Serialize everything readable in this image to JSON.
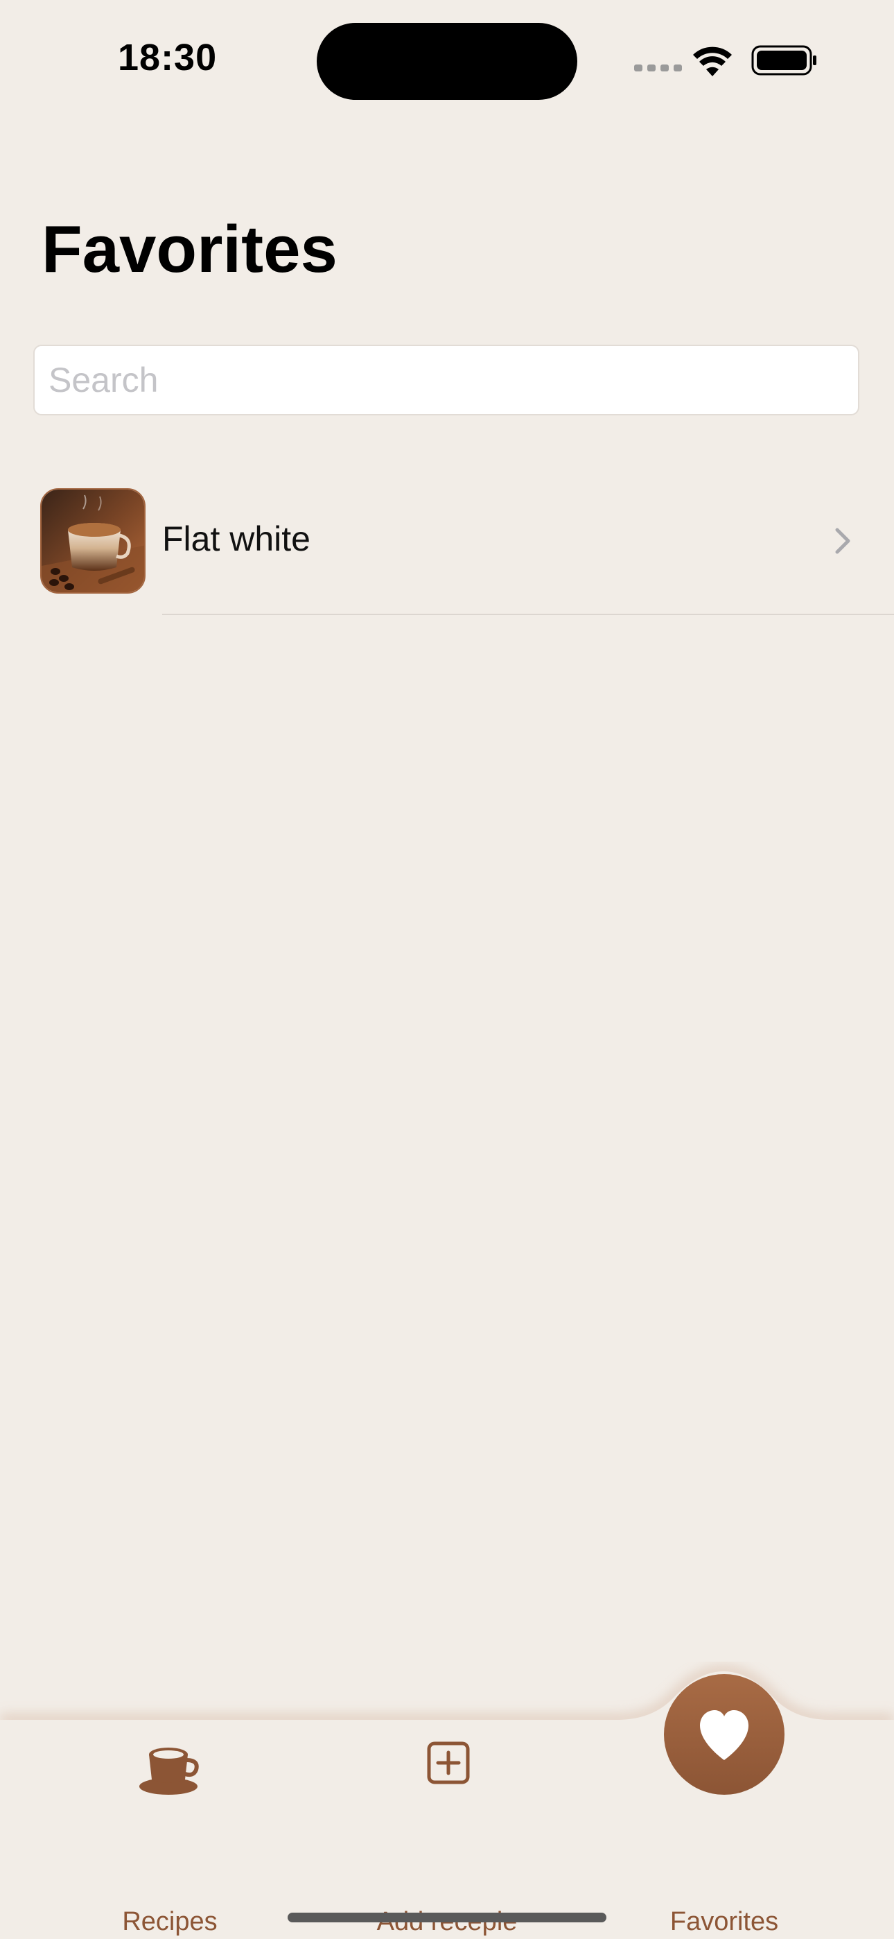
{
  "status_bar": {
    "time": "18:30"
  },
  "page": {
    "title": "Favorites"
  },
  "search": {
    "placeholder": "Search",
    "value": ""
  },
  "list": {
    "items": [
      {
        "label": "Flat white",
        "thumbnail": "cappuccino-cup-photo"
      }
    ]
  },
  "tab_bar": {
    "tabs": [
      {
        "label": "Recipes",
        "icon": "coffee-cup-icon",
        "selected": false
      },
      {
        "label": "Add recepie",
        "icon": "plus-square-icon",
        "selected": false
      },
      {
        "label": "Favorites",
        "icon": "heart-icon",
        "selected": true
      }
    ]
  },
  "colors": {
    "background": "#f2ede7",
    "accent": "#8c5535",
    "accent_light": "#a86b45"
  }
}
